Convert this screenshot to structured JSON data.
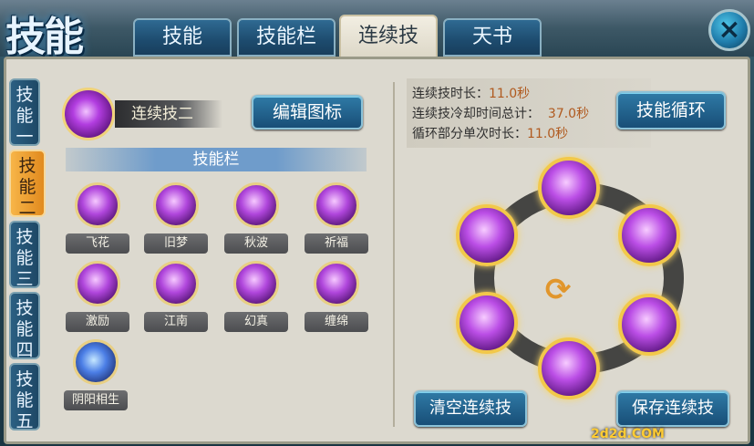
{
  "title": "技能",
  "tabs": [
    {
      "label": "技能",
      "active": false
    },
    {
      "label": "技能栏",
      "active": false
    },
    {
      "label": "连续技",
      "active": true
    },
    {
      "label": "天书",
      "active": false
    }
  ],
  "side_tabs": [
    {
      "label_top": "技",
      "label_bottom": "能一",
      "active": false
    },
    {
      "label_top": "技",
      "label_bottom": "能二",
      "active": true
    },
    {
      "label_top": "技",
      "label_bottom": "能三",
      "active": false
    },
    {
      "label_top": "技",
      "label_bottom": "能四",
      "active": false
    },
    {
      "label_top": "技",
      "label_bottom": "能五",
      "active": false
    }
  ],
  "combo": {
    "label": "连续技二",
    "edit_button": "编辑图标"
  },
  "skill_bar": {
    "header": "技能栏",
    "skills": [
      "飞花",
      "旧梦",
      "秋波",
      "祈福",
      "激励",
      "江南",
      "幻真",
      "缠绵",
      "阴阳相生"
    ]
  },
  "info": {
    "duration_label": "连续技时长：",
    "duration_value": "11.0秒",
    "cooldown_label": "连续技冷却时间总计：",
    "cooldown_value": "37.0秒",
    "cycle_label": "循环部分单次时长：",
    "cycle_value": "11.0秒"
  },
  "buttons": {
    "loop": "技能循环",
    "clear": "清空连续技",
    "save": "保存连续技"
  },
  "close_icon": "×",
  "cycle_icon": "⟳",
  "watermark": "2d2d.COM",
  "colors": {
    "accent_gold": "#f2c84a",
    "tab_blue": "#1d4b6e",
    "active_orange": "#e18a1e",
    "value_brown": "#b05a1f"
  }
}
